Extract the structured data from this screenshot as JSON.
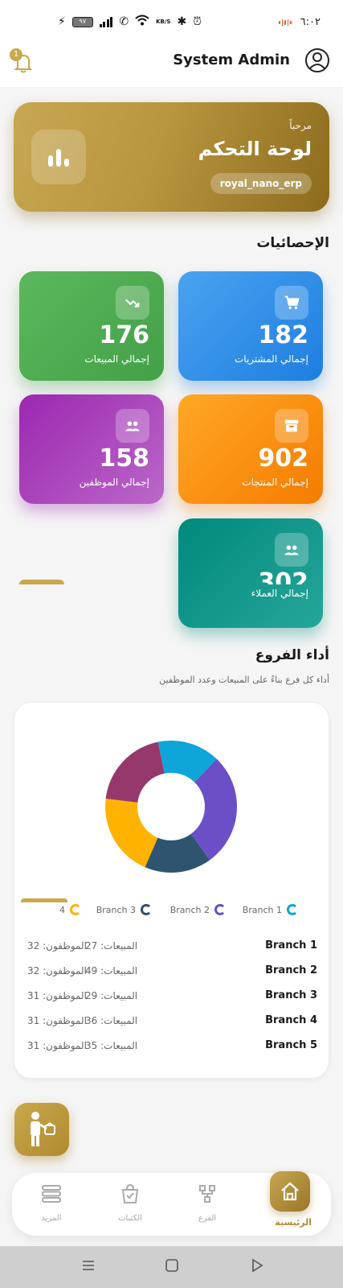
{
  "status_bar": {
    "time": "٦:٠٢",
    "battery": "٩٧",
    "net_speed_unit": "KB/S"
  },
  "header": {
    "title": "System Admin",
    "notification_count": "1"
  },
  "banner": {
    "greeting": "مرحباً",
    "title": "لوحة التحكم",
    "chip": "royal_nano_erp"
  },
  "stats": {
    "title": "الإحصائيات",
    "cards": [
      {
        "label": "إجمالي المشتريات",
        "value": "182",
        "icon": "cart-icon",
        "color": "#1e7ee0"
      },
      {
        "label": "إجمالي المبيعات",
        "value": "176",
        "icon": "trending-icon",
        "color": "#43a047"
      },
      {
        "label": "إجمالي المنتجات",
        "value": "902",
        "icon": "archive-icon",
        "color": "#f57c00"
      },
      {
        "label": "إجمالي الموظفين",
        "value": "158",
        "icon": "people-icon",
        "color": "#9c27b0"
      },
      {
        "label": "إجمالي العملاء",
        "value": "302",
        "icon": "people-icon",
        "color": "#00897b"
      }
    ]
  },
  "branches": {
    "title": "أداء الفروع",
    "subtitle": "أداء كل فرع بناءً على المبيعات وعدد الموظفين",
    "sales_label": "المبيعات:",
    "employees_label": "الموظفون:",
    "legend": [
      {
        "name": "Branch 1",
        "color": "#0ea5d9"
      },
      {
        "name": "Branch 2",
        "color": "#6a4fc7"
      },
      {
        "name": "Branch 3",
        "color": "#2f4f6b"
      },
      {
        "name": "4",
        "color": "#ffb300"
      }
    ],
    "rows": [
      {
        "name": "Branch 1",
        "sales": "27",
        "employees": "32"
      },
      {
        "name": "Branch 2",
        "sales": "49",
        "employees": "32"
      },
      {
        "name": "Branch 3",
        "sales": "29",
        "employees": "31"
      },
      {
        "name": "Branch 4",
        "sales": "36",
        "employees": "31"
      },
      {
        "name": "Branch 5",
        "sales": "35",
        "employees": "31"
      }
    ]
  },
  "chart_data": {
    "type": "pie",
    "categories": [
      "Branch 1",
      "Branch 2",
      "Branch 3",
      "Branch 4",
      "Branch 5"
    ],
    "values": [
      27,
      49,
      29,
      36,
      35
    ],
    "colors": [
      "#0ea5d9",
      "#6a4fc7",
      "#2f5470",
      "#ffb300",
      "#96386b"
    ],
    "donut": true
  },
  "bottom_nav": {
    "home": "الرئيسية",
    "branch": "الفرع",
    "books": "الكتبات",
    "more": "المزيد"
  }
}
